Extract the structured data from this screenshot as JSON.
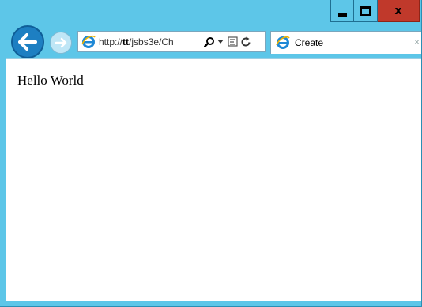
{
  "window": {
    "caption_buttons": {
      "minimize_icon": "minimize-icon",
      "maximize_icon": "maximize-icon",
      "close_label": "x"
    }
  },
  "toolbar": {
    "back_icon": "back-arrow-icon",
    "forward_icon": "forward-arrow-icon",
    "address": {
      "url_prefix": "http://",
      "url_host": "tt",
      "url_rest": "/jsbs3e/Ch"
    },
    "tab": {
      "title": "Create"
    }
  },
  "page": {
    "text": "Hello World"
  },
  "colors": {
    "frame": "#5dc6e8",
    "close_button": "#c0392b",
    "back_button": "#1d7fc2"
  }
}
